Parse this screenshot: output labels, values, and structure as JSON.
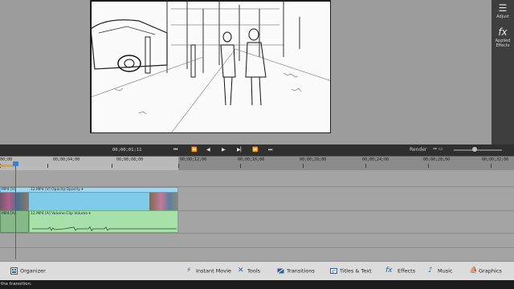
{
  "right_panel": {
    "adjust_label": "Adjust",
    "applied_effects_label": "Applied Effects"
  },
  "transport": {
    "timecode": "00;00;01;11",
    "render_label": "Render"
  },
  "ruler": {
    "labels": [
      "00;00",
      "00;00;04;00",
      "00;00;08;00",
      "00;00;12;00",
      "00;00;16;00",
      "00;00;20;00",
      "00;00;24;00",
      "00;00;28;00",
      "00;00;32;00"
    ]
  },
  "timeline": {
    "video_clip_a_label": "MP4 [V]",
    "video_clip_b_label": "12.MP4 [V] Opacity:Opacity ▾",
    "audio_clip_a_label": "MP4 [A]",
    "audio_clip_b_label": "12.MP4 [A] Volume:Clip Volume ▾"
  },
  "toolbar": {
    "organizer": "Organizer",
    "instant_movie": "Instant Movie",
    "tools": "Tools",
    "transitions": "Transitions",
    "titles_text": "Titles & Text",
    "effects": "Effects",
    "music": "Music",
    "graphics": "Graphics"
  },
  "status": {
    "text": "the transition."
  }
}
